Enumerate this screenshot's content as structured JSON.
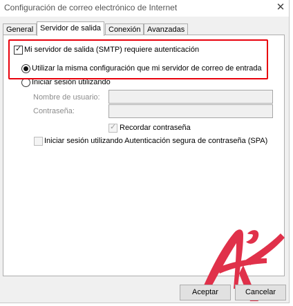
{
  "window": {
    "title": "Configuración de correo electrónico de Internet",
    "close_glyph": "✕"
  },
  "tabs": [
    {
      "label": "General",
      "active": false
    },
    {
      "label": "Servidor de salida",
      "active": true
    },
    {
      "label": "Conexión",
      "active": false
    },
    {
      "label": "Avanzadas",
      "active": false
    }
  ],
  "panel": {
    "smtp_auth": {
      "label": "Mi servidor de salida (SMTP) requiere autenticación",
      "checked": true
    },
    "same_settings": {
      "label": "Utilizar la misma configuración que mi servidor de correo de entrada",
      "selected": true
    },
    "login_using": {
      "label": "Iniciar sesión utilizando",
      "selected": false
    },
    "username": {
      "label": "Nombre de usuario:",
      "value": ""
    },
    "password": {
      "label": "Contraseña:",
      "value": ""
    },
    "remember_password": {
      "label": "Recordar contraseña",
      "checked": true,
      "disabled": true
    },
    "spa": {
      "label": "Iniciar sesión utilizando Autenticación segura de contraseña (SPA)",
      "checked": false,
      "disabled": true
    }
  },
  "buttons": {
    "ok": "Aceptar",
    "cancel": "Cancelar"
  },
  "colors": {
    "highlight": "#e8000b",
    "watermark": "#e0314a"
  },
  "icons": {
    "checkmark": "✓"
  }
}
